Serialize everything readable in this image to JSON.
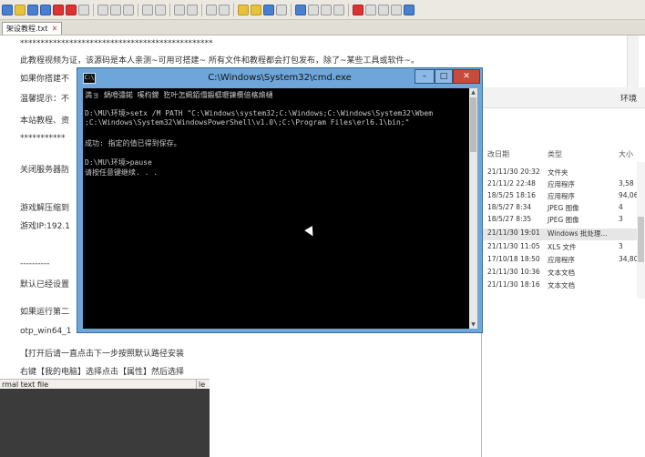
{
  "notepad": {
    "tab_label": "架设教程.txt",
    "lines": [
      "***********************************************",
      "此教程视频为证，该源码是本人亲测~可用可搭建~ 所有文件和教程都会打包发布，除了~某些工具或软件~。",
      "如果你搭建不",
      "温馨提示：不",
      "本站教程、资",
      "***********",
      "关闭服务器防",
      "游戏解压缩到",
      "游戏IP:192.1",
      "----------",
      "默认已经设置",
      "如果运行第二",
      "otp_win64_1",
      "【打开后请一直点击下一步按照默认路径安装",
      "右键【我的电脑】选择点击【属性】然后选择"
    ],
    "status_left": "rmal text file",
    "status_right": "le"
  },
  "explorer": {
    "title": "环境",
    "columns": {
      "date": "改日期",
      "type": "类型",
      "size": "大小"
    },
    "rows": [
      {
        "date": "21/11/30 20:32",
        "type": "文件夹",
        "size": ""
      },
      {
        "date": "21/11/2 22:48",
        "type": "应用程序",
        "size": "3,58"
      },
      {
        "date": "18/5/25 18:16",
        "type": "应用程序",
        "size": "94,06"
      },
      {
        "date": "18/5/27 8:34",
        "type": "JPEG 图像",
        "size": "4"
      },
      {
        "date": "18/5/27 8:35",
        "type": "JPEG 图像",
        "size": "3"
      },
      {
        "date": "21/11/30 19:01",
        "type": "Windows 批处理...",
        "size": ""
      },
      {
        "date": "21/11/30 11:05",
        "type": "XLS 文件",
        "size": "3"
      },
      {
        "date": "17/10/18 18:50",
        "type": "应用程序",
        "size": "34,80"
      },
      {
        "date": "21/11/30 10:36",
        "type": "文本文档",
        "size": ""
      },
      {
        "date": "21/11/30 18:16",
        "type": "文本文档",
        "size": ""
      }
    ]
  },
  "cmd": {
    "title": "C:\\Windows\\System32\\cmd.exe",
    "buttons": {
      "minimize": "–",
      "maximize": "□",
      "close": "✕"
    },
    "lines": [
      "満ョ  鍋嗗彇鍩  嗘枃鍐  犵叶怎姵銆傝鍛樼瓑鍊欑偣楁燴樋",
      "",
      "D:\\MU\\环境>setx /M PATH \"C:\\Windows\\system32;C:\\Windows;C:\\Windows\\System32\\Wbem",
      ";C:\\Windows\\System32\\WindowsPowerShell\\v1.0\\;C:\\Program Files\\erl6.1\\bin;\"",
      "",
      "成功: 指定的值已得到保存。",
      "",
      "D:\\MU\\环境>pause",
      "请按任意键继续. . ."
    ]
  }
}
